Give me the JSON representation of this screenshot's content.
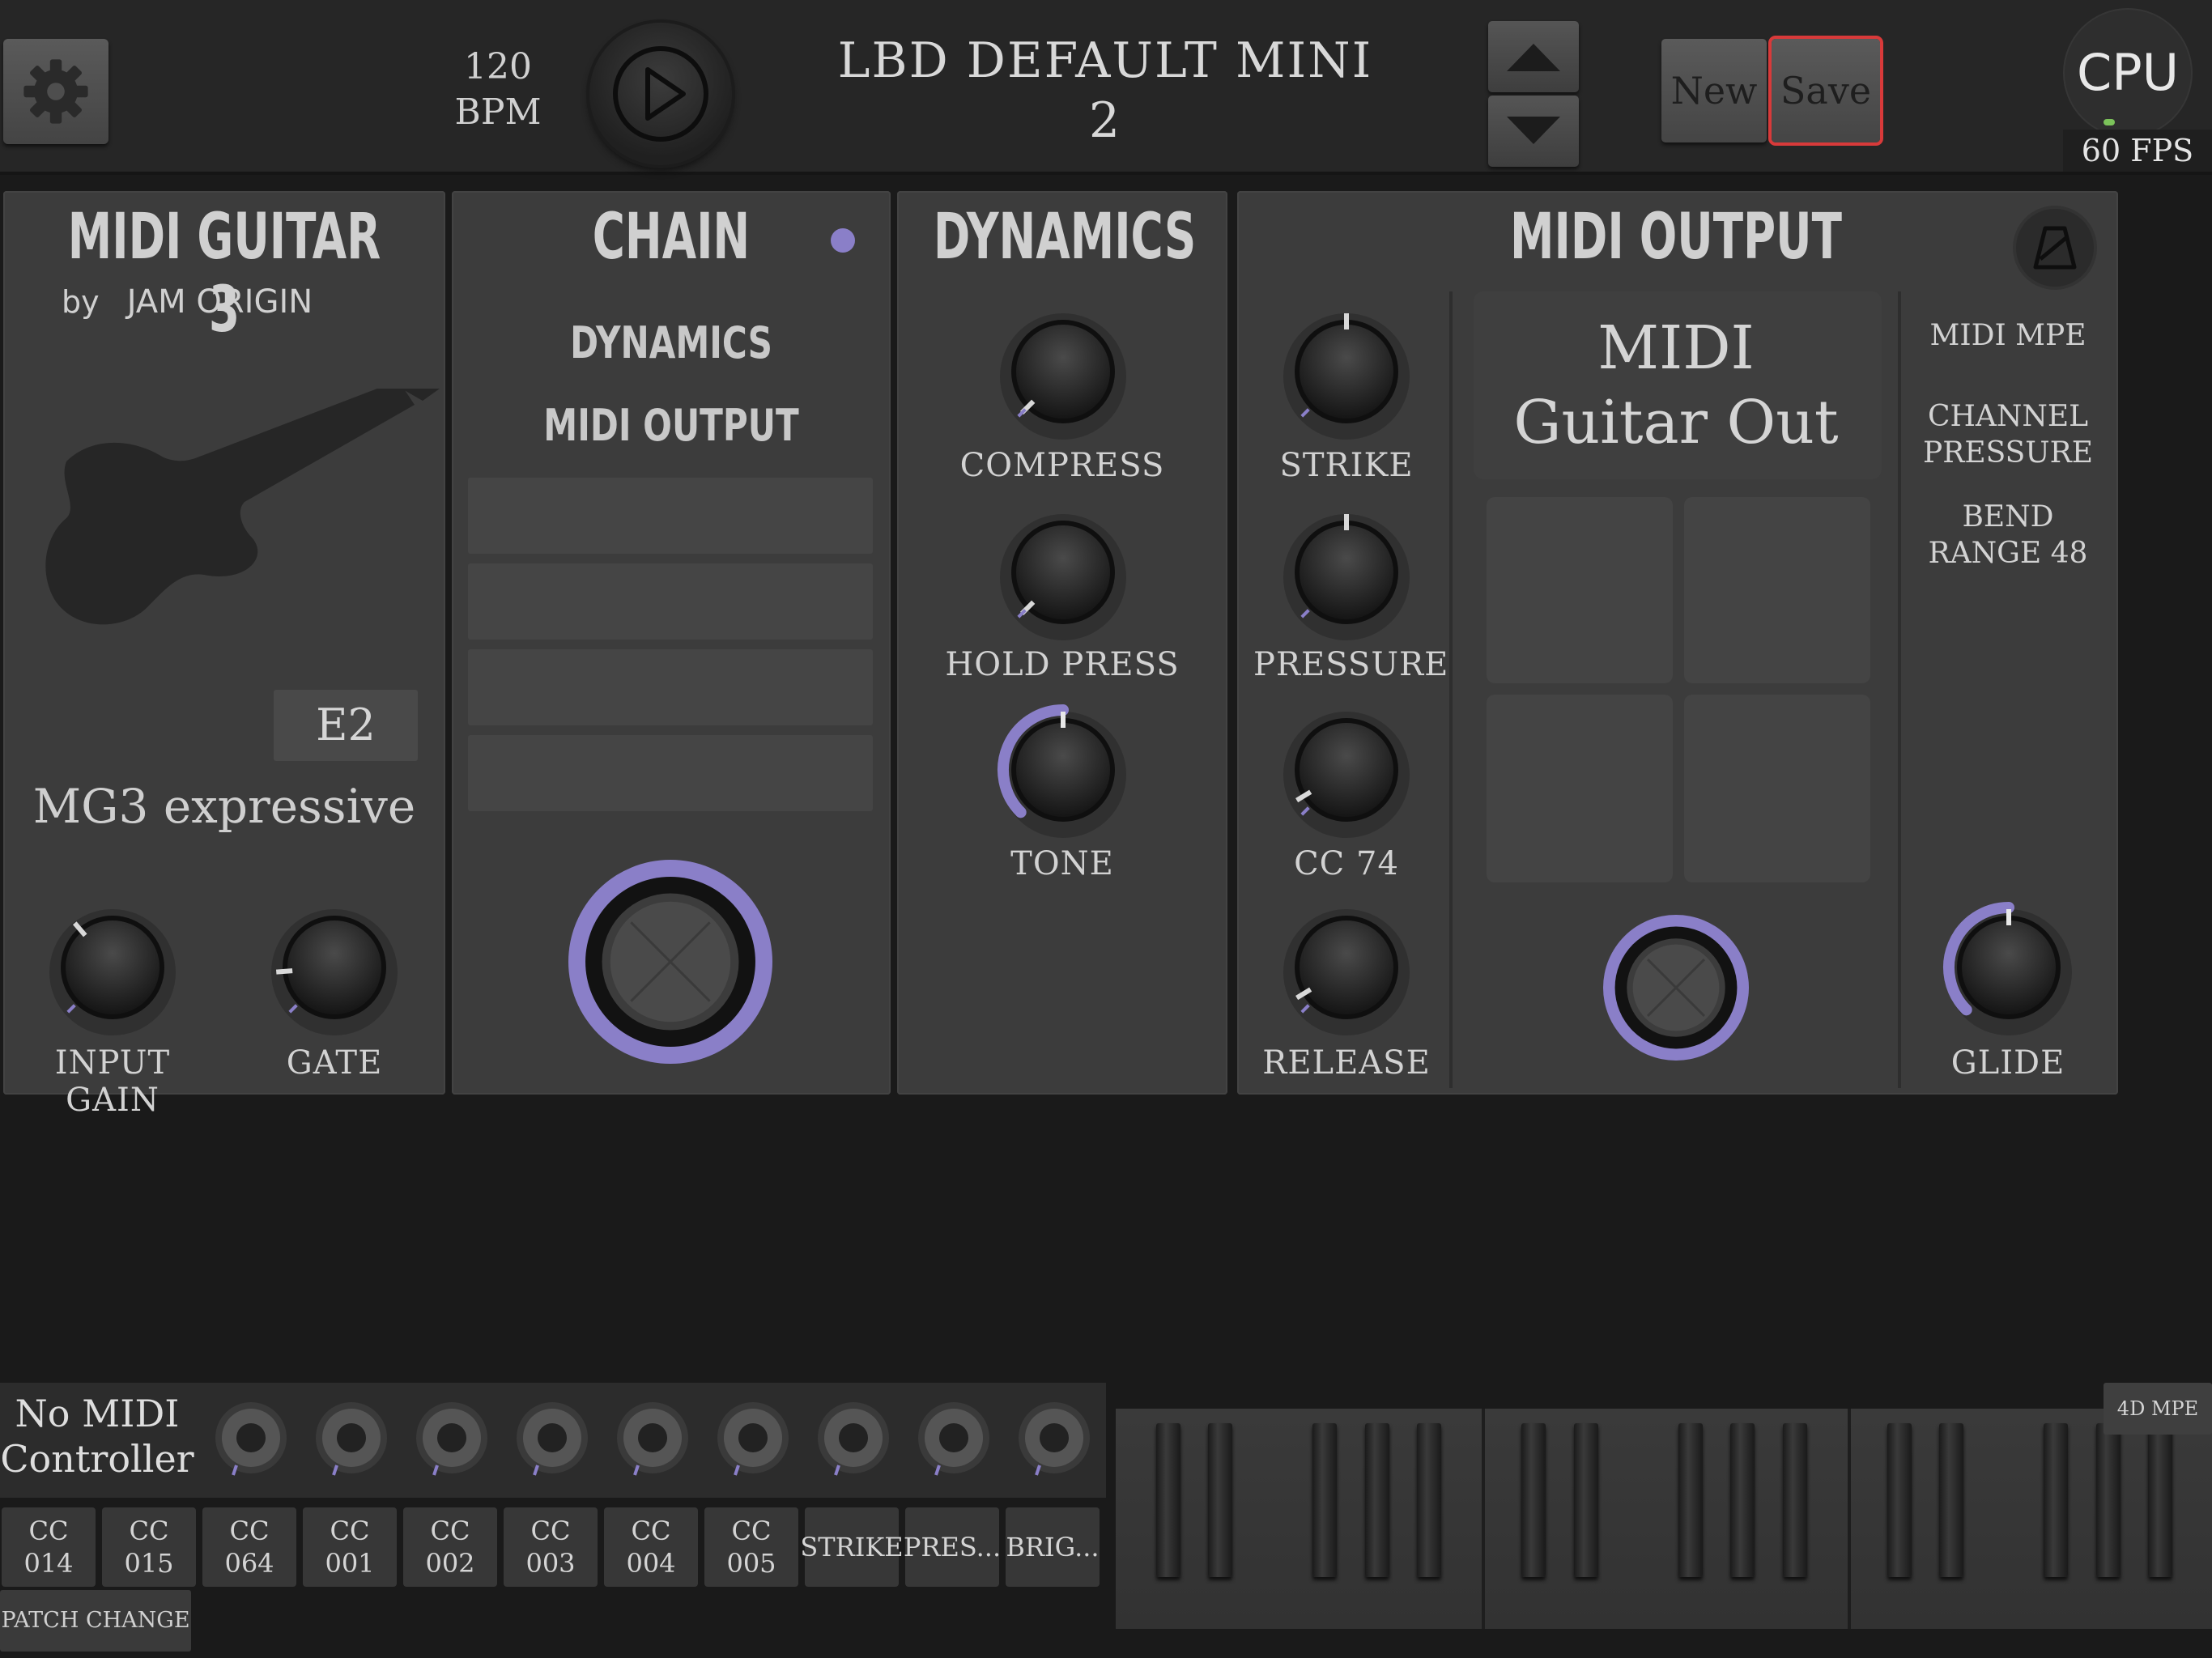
{
  "topbar": {
    "tempo_value": "120",
    "tempo_unit": "BPM",
    "preset_name_line1": "LBD DEFAULT MINI",
    "preset_name_line2": "2",
    "new_label": "New",
    "save_label": "Save",
    "cpu_label": "CPU",
    "fps_label": "60 FPS",
    "icons": [
      "gear-icon",
      "play-icon",
      "arrow-up-icon",
      "arrow-down-icon"
    ]
  },
  "midi_guitar": {
    "title": "MIDI GUITAR 3",
    "by_prefix": "by",
    "maker": "JAM ORIGIN",
    "note_label": "E2",
    "preset_name": "MG3 expressive",
    "knobs": [
      {
        "label": "INPUT GAIN",
        "value": 0.35
      },
      {
        "label": "GATE",
        "value": 0.15
      }
    ]
  },
  "chain": {
    "title": "CHAIN",
    "items": [
      "DYNAMICS",
      "MIDI OUTPUT"
    ],
    "empty_slots": 4,
    "bypass_level": 1.0
  },
  "dynamics": {
    "title": "DYNAMICS",
    "knobs": [
      {
        "label": "COMPRESS",
        "value": 0.0
      },
      {
        "label": "HOLD PRESS",
        "value": 0.0
      },
      {
        "label": "TONE",
        "value": 0.5
      }
    ]
  },
  "midi_output": {
    "title": "MIDI OUTPUT",
    "knobs": [
      {
        "label": "STRIKE",
        "value": 0.5
      },
      {
        "label": "PRESSURE",
        "value": 0.5
      },
      {
        "label": "CC 74",
        "value": 0.05
      },
      {
        "label": "RELEASE",
        "value": 0.05
      }
    ],
    "center_title_line1": "MIDI",
    "center_title_line2": "Guitar Out",
    "side_options": [
      "MIDI MPE",
      "CHANNEL PRESSURE",
      "BEND RANGE 48"
    ],
    "glide_label": "GLIDE",
    "glide_value": 0.5
  },
  "controller": {
    "name_line1": "No MIDI",
    "name_line2": "Controller",
    "knob_count": 9,
    "buttons": [
      {
        "l1": "CC",
        "l2": "014"
      },
      {
        "l1": "CC",
        "l2": "015"
      },
      {
        "l1": "CC",
        "l2": "064"
      },
      {
        "l1": "CC",
        "l2": "001"
      },
      {
        "l1": "CC",
        "l2": "002"
      },
      {
        "l1": "CC",
        "l2": "003"
      },
      {
        "l1": "CC",
        "l2": "004"
      },
      {
        "l1": "CC",
        "l2": "005"
      },
      {
        "l1": "STRIKE",
        "l2": ""
      },
      {
        "l1": "PRES...",
        "l2": ""
      },
      {
        "l1": "BRIG...",
        "l2": ""
      }
    ],
    "patch_change_label": "PATCH CHANGE",
    "mpe_label": "4D MPE"
  },
  "colors": {
    "accent": "#8a7fc8",
    "save_border": "#d83a3a",
    "cpu_indicator": "#7bc25a"
  }
}
